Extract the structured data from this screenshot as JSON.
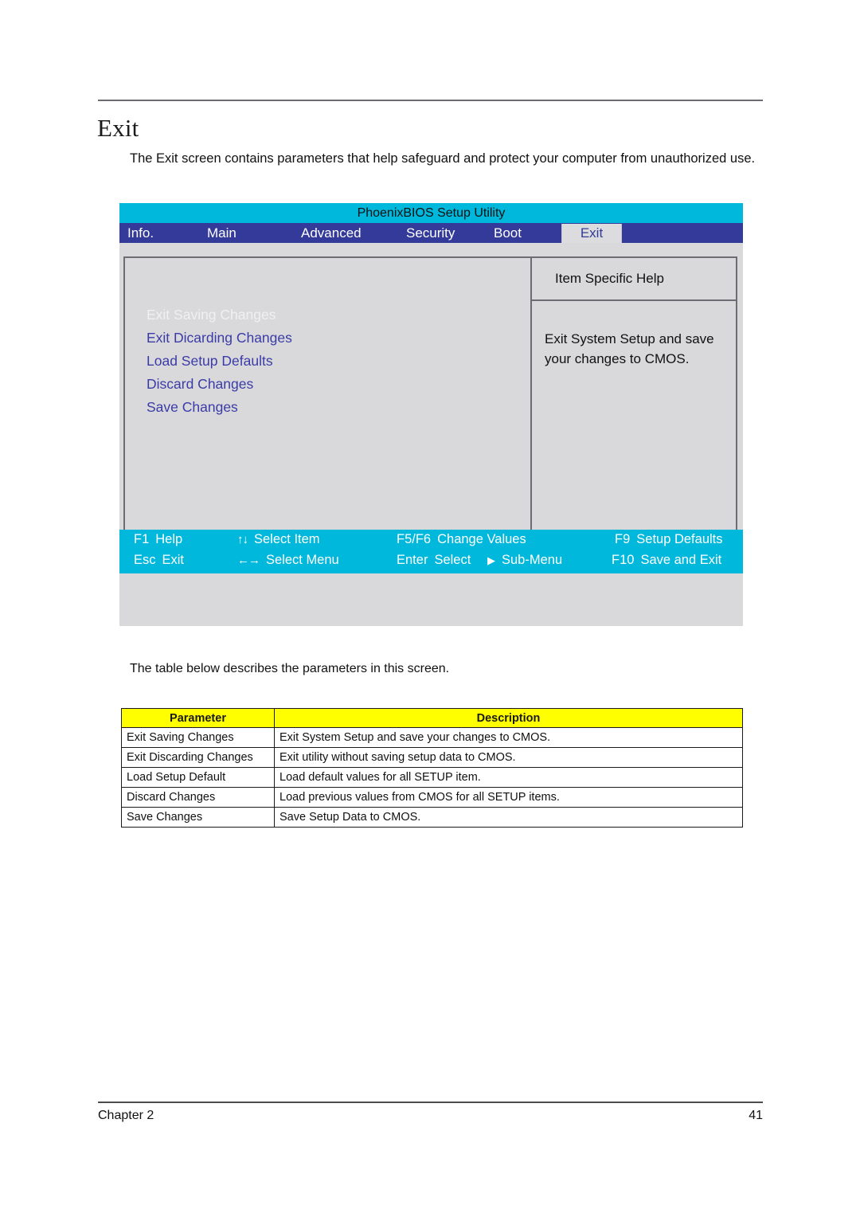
{
  "document": {
    "page_heading": "Exit",
    "intro_paragraph": "The Exit screen contains parameters that help safeguard and protect your computer from unauthorized use.",
    "table_intro": "The table below describes the parameters in this screen.",
    "footer_chapter": "Chapter 2",
    "footer_page": "41"
  },
  "bios": {
    "title": "PhoenixBIOS Setup Utility",
    "tabs": [
      {
        "label": "Info.",
        "active": false
      },
      {
        "label": "Main",
        "active": false
      },
      {
        "label": "Advanced",
        "active": false
      },
      {
        "label": "Security",
        "active": false
      },
      {
        "label": "Boot",
        "active": false
      },
      {
        "label": "Exit",
        "active": true
      }
    ],
    "menu_items": [
      {
        "label": "Exit Saving Changes",
        "selected": true
      },
      {
        "label": "Exit Dicarding Changes",
        "selected": false
      },
      {
        "label": "Load Setup Defaults",
        "selected": false
      },
      {
        "label": "Discard Changes",
        "selected": false
      },
      {
        "label": "Save Changes",
        "selected": false
      }
    ],
    "help": {
      "title": "Item Specific Help",
      "text": "Exit System Setup and save your changes to CMOS."
    },
    "keybar": {
      "row1": [
        {
          "key": "F1",
          "glyph": "",
          "label": "Help"
        },
        {
          "key": "",
          "glyph": "↑↓",
          "label": "Select Item"
        },
        {
          "key": "F5/F6",
          "glyph": "",
          "label": "Change Values"
        },
        {
          "key": "F9",
          "glyph": "",
          "label": "Setup Defaults"
        }
      ],
      "row2": [
        {
          "key": "Esc",
          "glyph": "",
          "label": "Exit"
        },
        {
          "key": "",
          "glyph": "←→",
          "label": "Select Menu"
        },
        {
          "key": "Enter",
          "glyph": "",
          "label": "Select"
        },
        {
          "key": "",
          "glyph": "▶",
          "label": "Sub-Menu"
        },
        {
          "key": "F10",
          "glyph": "",
          "label": "Save and Exit"
        }
      ]
    },
    "colors": {
      "titlebar": "#00b8dc",
      "menubar": "#333a99",
      "panel": "#d9d9db",
      "menu_item_text": "#3b3ba8",
      "keybar": "#00b8dc"
    }
  },
  "parameter_table": {
    "headers": [
      "Parameter",
      "Description"
    ],
    "header_background": "#ffff00",
    "rows": [
      [
        "Exit Saving Changes",
        "Exit System Setup and save your changes to CMOS."
      ],
      [
        "Exit Discarding Changes",
        "Exit utility without saving setup data to CMOS."
      ],
      [
        "Load Setup Default",
        "Load default values for all SETUP item."
      ],
      [
        "Discard Changes",
        "Load previous values from CMOS for all SETUP items."
      ],
      [
        "Save Changes",
        "Save Setup Data to CMOS."
      ]
    ]
  }
}
